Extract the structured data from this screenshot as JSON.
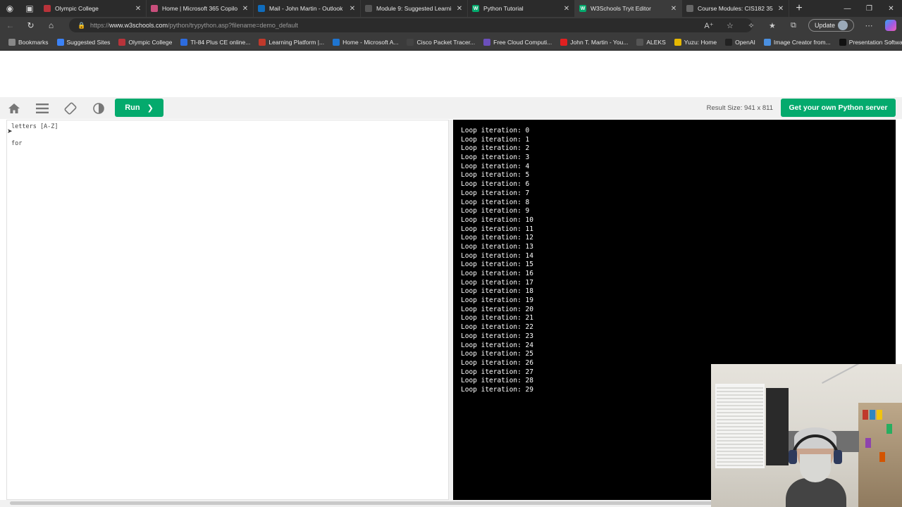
{
  "browser": {
    "tabs": [
      {
        "title": "Olympic College",
        "fav_color": "#b8333a",
        "fav_char": "",
        "active": false
      },
      {
        "title": "Home | Microsoft 365 Copilot",
        "fav_color": "#c94f7c",
        "fav_char": "",
        "active": false
      },
      {
        "title": "Mail - John Martin - Outlook",
        "fav_color": "#0f6cbd",
        "fav_char": "",
        "active": false
      },
      {
        "title": "Module 9: Suggested Learning M",
        "fav_color": "#555555",
        "fav_char": "",
        "active": false
      },
      {
        "title": "Python Tutorial",
        "fav_color": "#04aa6d",
        "fav_char": "W",
        "active": false
      },
      {
        "title": "W3Schools Tryit Editor",
        "fav_color": "#04aa6d",
        "fav_char": "W",
        "active": true
      },
      {
        "title": "Course Modules: CIS182 35529",
        "fav_color": "#666666",
        "fav_char": "",
        "active": false
      }
    ],
    "url_prefix": "https://",
    "url_host": "www.w3schools.com",
    "url_path": "/python/trypython.asp?filename=demo_default",
    "update_label": "Update",
    "bookmarks": [
      {
        "label": "Bookmarks",
        "color": "#888888"
      },
      {
        "label": "Suggested Sites",
        "color": "#3b82f6"
      },
      {
        "label": "Olympic College",
        "color": "#b8333a"
      },
      {
        "label": "TI-84 Plus CE online...",
        "color": "#2d6cdf"
      },
      {
        "label": "Learning Platform |...",
        "color": "#c0392b"
      },
      {
        "label": "Home - Microsoft A...",
        "color": "#1f75d0"
      },
      {
        "label": "Cisco Packet Tracer...",
        "color": "#444444"
      },
      {
        "label": "Free Cloud Computi...",
        "color": "#6b4fbb"
      },
      {
        "label": "John T. Martin - You...",
        "color": "#e02020"
      },
      {
        "label": "ALEKS",
        "color": "#555555"
      },
      {
        "label": "Yuzu: Home",
        "color": "#e6b800"
      },
      {
        "label": "OpenAI",
        "color": "#222222"
      },
      {
        "label": "Image Creator from...",
        "color": "#4a8fe0"
      },
      {
        "label": "Presentation Softwa...",
        "color": "#111111"
      }
    ]
  },
  "editor_toolbar": {
    "run_label": "Run",
    "result_size": "Result Size: 941 x 811",
    "server_label": "Get your own Python server"
  },
  "editor": {
    "lines": [
      "letters [A-Z]",
      "for"
    ]
  },
  "output": {
    "lines": [
      "Loop iteration: 0",
      "Loop iteration: 1",
      "Loop iteration: 2",
      "Loop iteration: 3",
      "Loop iteration: 4",
      "Loop iteration: 5",
      "Loop iteration: 6",
      "Loop iteration: 7",
      "Loop iteration: 8",
      "Loop iteration: 9",
      "Loop iteration: 10",
      "Loop iteration: 11",
      "Loop iteration: 12",
      "Loop iteration: 13",
      "Loop iteration: 14",
      "Loop iteration: 15",
      "Loop iteration: 16",
      "Loop iteration: 17",
      "Loop iteration: 18",
      "Loop iteration: 19",
      "Loop iteration: 20",
      "Loop iteration: 21",
      "Loop iteration: 22",
      "Loop iteration: 23",
      "Loop iteration: 24",
      "Loop iteration: 25",
      "Loop iteration: 26",
      "Loop iteration: 27",
      "Loop iteration: 28",
      "Loop iteration: 29"
    ]
  },
  "colors": {
    "accent": "#04aa6d",
    "output_bg": "#000000",
    "output_fg": "#ffffff"
  }
}
